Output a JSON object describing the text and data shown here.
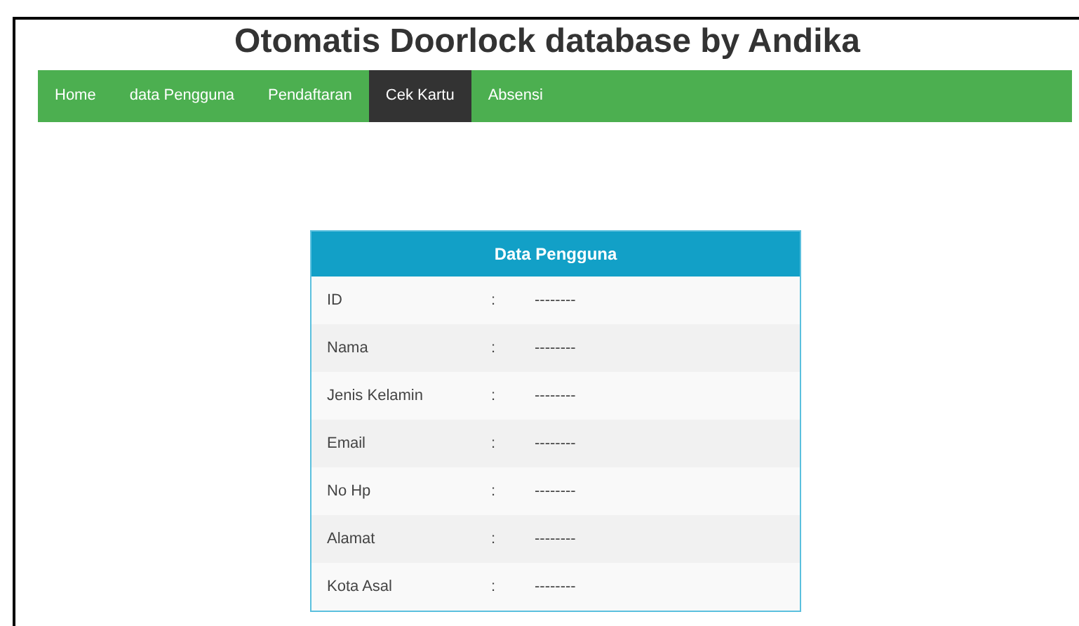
{
  "title": "Otomatis Doorlock database by Andika",
  "nav": [
    {
      "label": "Home",
      "selected": false
    },
    {
      "label": "data Pengguna",
      "selected": false
    },
    {
      "label": "Pendaftaran",
      "selected": false
    },
    {
      "label": "Cek Kartu",
      "selected": true
    },
    {
      "label": "Absensi",
      "selected": false
    }
  ],
  "card": {
    "title": "Data Pengguna",
    "separator": ":",
    "rows": [
      {
        "label": "ID",
        "value": "--------"
      },
      {
        "label": "Nama",
        "value": "--------"
      },
      {
        "label": "Jenis Kelamin",
        "value": "--------"
      },
      {
        "label": "Email",
        "value": "--------"
      },
      {
        "label": "No Hp",
        "value": "--------"
      },
      {
        "label": "Alamat",
        "value": "--------"
      },
      {
        "label": "Kota Asal",
        "value": "--------"
      }
    ]
  }
}
